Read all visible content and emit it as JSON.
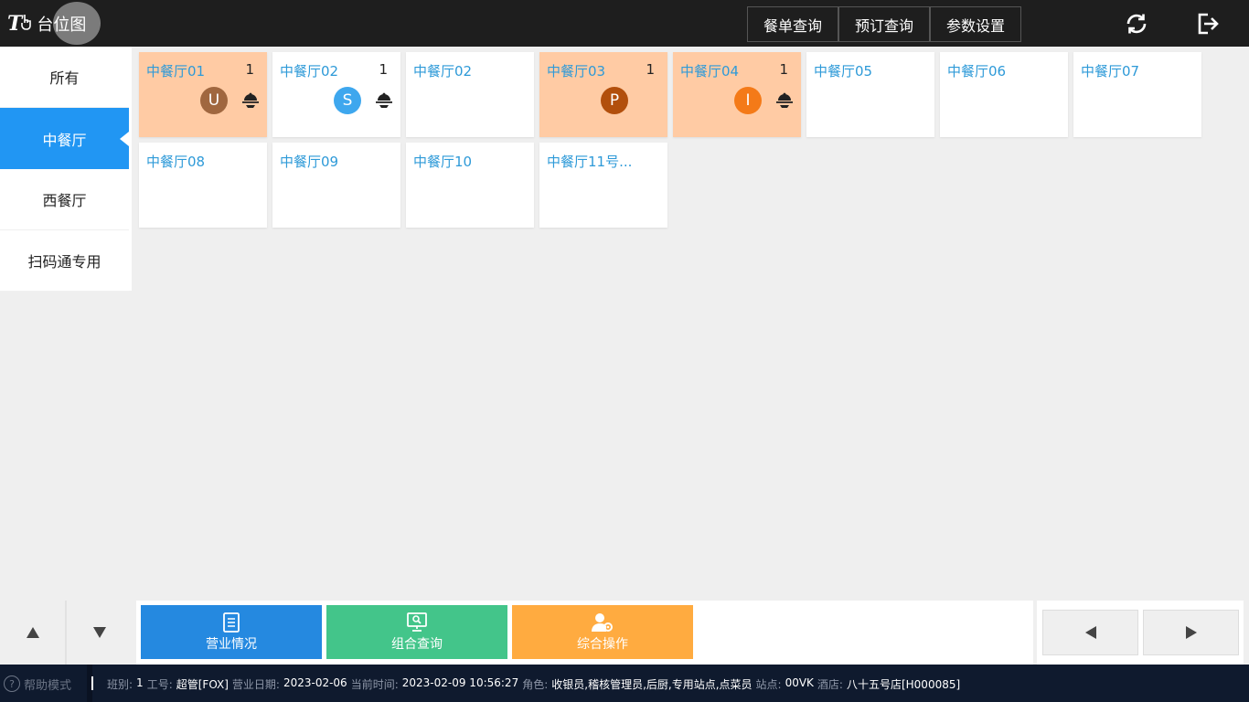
{
  "app": {
    "logo_mark": "T",
    "title": "台位图"
  },
  "header": {
    "buttons": [
      {
        "label": "餐单查询"
      },
      {
        "label": "预订查询"
      },
      {
        "label": "参数设置"
      }
    ],
    "icons": [
      "refresh-icon",
      "logout-icon"
    ]
  },
  "sidebar": {
    "items": [
      {
        "label": "所有",
        "active": false
      },
      {
        "label": "中餐厅",
        "active": true
      },
      {
        "label": "西餐厅",
        "active": false
      },
      {
        "label": "扫码通专用",
        "active": false
      }
    ]
  },
  "tables": [
    {
      "name": "中餐厅01",
      "count": "1",
      "occupied": true,
      "avatar": "U",
      "avatar_color": "#a0673f",
      "dish": true
    },
    {
      "name": "中餐厅02",
      "count": "1",
      "occupied": false,
      "avatar": "S",
      "avatar_color": "#3ea7ee",
      "dish": true
    },
    {
      "name": "中餐厅02",
      "count": "",
      "occupied": false,
      "avatar": "",
      "avatar_color": "",
      "dish": false
    },
    {
      "name": "中餐厅03",
      "count": "1",
      "occupied": true,
      "avatar": "P",
      "avatar_color": "#b24f0c",
      "dish": false
    },
    {
      "name": "中餐厅04",
      "count": "1",
      "occupied": true,
      "avatar": "I",
      "avatar_color": "#f47a18",
      "dish": true
    },
    {
      "name": "中餐厅05",
      "count": "",
      "occupied": false,
      "avatar": "",
      "avatar_color": "",
      "dish": false
    },
    {
      "name": "中餐厅06",
      "count": "",
      "occupied": false,
      "avatar": "",
      "avatar_color": "",
      "dish": false
    },
    {
      "name": "中餐厅07",
      "count": "",
      "occupied": false,
      "avatar": "",
      "avatar_color": "",
      "dish": false
    },
    {
      "name": "中餐厅08",
      "count": "",
      "occupied": false,
      "avatar": "",
      "avatar_color": "",
      "dish": false
    },
    {
      "name": "中餐厅09",
      "count": "",
      "occupied": false,
      "avatar": "",
      "avatar_color": "",
      "dish": false
    },
    {
      "name": "中餐厅10",
      "count": "",
      "occupied": false,
      "avatar": "",
      "avatar_color": "",
      "dish": false
    },
    {
      "name": "中餐厅11号...",
      "count": "",
      "occupied": false,
      "avatar": "",
      "avatar_color": "",
      "dish": false
    }
  ],
  "actions": [
    {
      "label": "营业情况",
      "icon": "report-icon",
      "color": "#2589e0"
    },
    {
      "label": "组合查询",
      "icon": "monitor-search-icon",
      "color": "#43c58a"
    },
    {
      "label": "综合操作",
      "icon": "user-settings-icon",
      "color": "#ffab40"
    }
  ],
  "colors": {
    "header_bg": "#1e1e1e",
    "accent_blue": "#2196f3",
    "occupied_bg": "#ffcba4",
    "table_name": "#2e9ad8",
    "status_bg": "#0f1a2e"
  },
  "status": {
    "help_label": "帮助模式",
    "shift_label": "班别:",
    "shift_value": "1",
    "staff_label": "工号:",
    "staff_value": "超管[FOX]",
    "bizdate_label": "营业日期:",
    "bizdate_value": "2023-02-06",
    "time_label": "当前时间:",
    "time_value": "2023-02-09 10:56:27",
    "role_label": "角色:",
    "role_value": "收银员,稽核管理员,后厨,专用站点,点菜员",
    "station_label": "站点:",
    "station_value": "00VK",
    "hotel_label": "酒店:",
    "hotel_value": "八十五号店[H000085]"
  }
}
